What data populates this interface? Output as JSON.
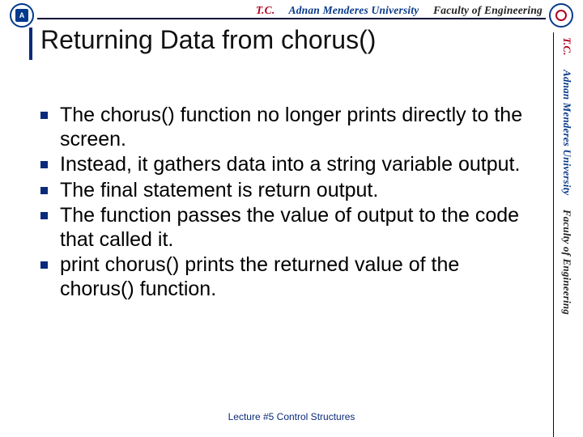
{
  "banner": {
    "tc": "T.C.",
    "university": "Adnan Menderes University",
    "faculty": "Faculty of Engineering"
  },
  "title": "Returning Data from chorus()",
  "bullets": [
    "The chorus() function no longer prints directly to the screen.",
    "Instead, it gathers data into a string variable output.",
    "The final statement is return output.",
    "The function passes the value of output to the code that called it.",
    "print chorus() prints the returned value of the chorus() function."
  ],
  "footer": "Lecture #5 Control Structures"
}
